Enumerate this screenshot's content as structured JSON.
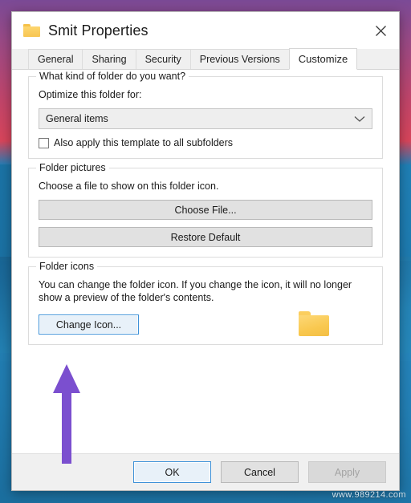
{
  "window": {
    "title": "Smit Properties",
    "title_icon": "folder-icon",
    "close_icon": "close-icon"
  },
  "tabs": [
    {
      "label": "General",
      "active": false
    },
    {
      "label": "Sharing",
      "active": false
    },
    {
      "label": "Security",
      "active": false
    },
    {
      "label": "Previous Versions",
      "active": false
    },
    {
      "label": "Customize",
      "active": true
    }
  ],
  "groups": {
    "folder_type": {
      "legend": "What kind of folder do you want?",
      "label": "Optimize this folder for:",
      "combo": {
        "value": "General items",
        "chevron_icon": "chevron-down-icon"
      },
      "checkbox": {
        "label": "Also apply this template to all subfolders",
        "checked": false
      }
    },
    "folder_pictures": {
      "legend": "Folder pictures",
      "description": "Choose a file to show on this folder icon.",
      "choose_file_label": "Choose File...",
      "restore_default_label": "Restore Default"
    },
    "folder_icons": {
      "legend": "Folder icons",
      "description": "You can change the folder icon. If you change the icon, it will no longer show a preview of the folder's contents.",
      "change_icon_label": "Change Icon...",
      "preview_icon": "folder-icon"
    }
  },
  "footer": {
    "ok_label": "OK",
    "cancel_label": "Cancel",
    "apply_label": "Apply",
    "apply_disabled": true
  },
  "annotation": {
    "arrow_color": "#7b4fcf",
    "points_to": "change-icon-button"
  },
  "watermark": {
    "text": "www.989214.com"
  },
  "colors": {
    "accent_focus": "#3d91d8",
    "folder_yellow": "#f9c84f",
    "dialog_bg": "#ffffff",
    "footer_bg": "#f0f0f0"
  }
}
